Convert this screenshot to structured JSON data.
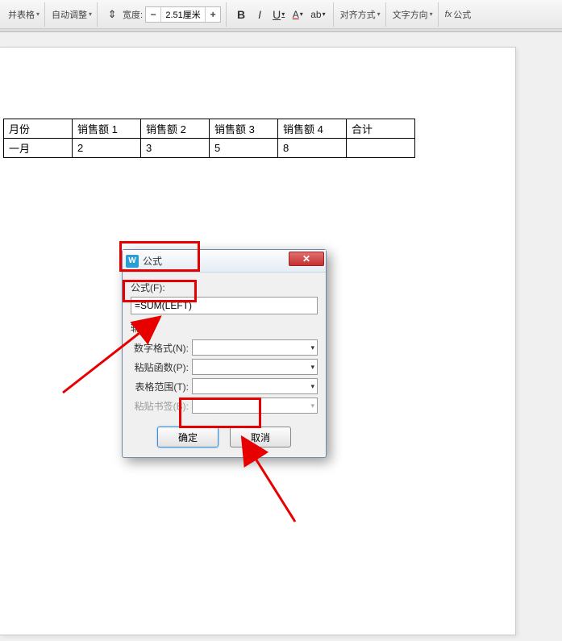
{
  "toolbar": {
    "merge_table_label": "并表格",
    "auto_adjust_label": "自动调整",
    "width_label": "宽度:",
    "width_value": "2.51厘米",
    "align_label": "对齐方式",
    "text_dir_label": "文字方向",
    "formula_label": "公式"
  },
  "table": {
    "headers": [
      "月份",
      "销售额 1",
      "销售额 2",
      "销售额 3",
      "销售额 4",
      "合计"
    ],
    "rows": [
      [
        "一月",
        "2",
        "3",
        "5",
        "8",
        ""
      ]
    ]
  },
  "dialog": {
    "title": "公式",
    "formula_label": "公式(F):",
    "formula_value": "=SUM(LEFT)",
    "aux_label": "辅助:",
    "num_format_label": "数字格式(N):",
    "paste_func_label": "粘贴函数(P):",
    "table_range_label": "表格范围(T):",
    "paste_bookmark_label": "粘贴书签(B):",
    "ok_label": "确定",
    "cancel_label": "取消"
  }
}
